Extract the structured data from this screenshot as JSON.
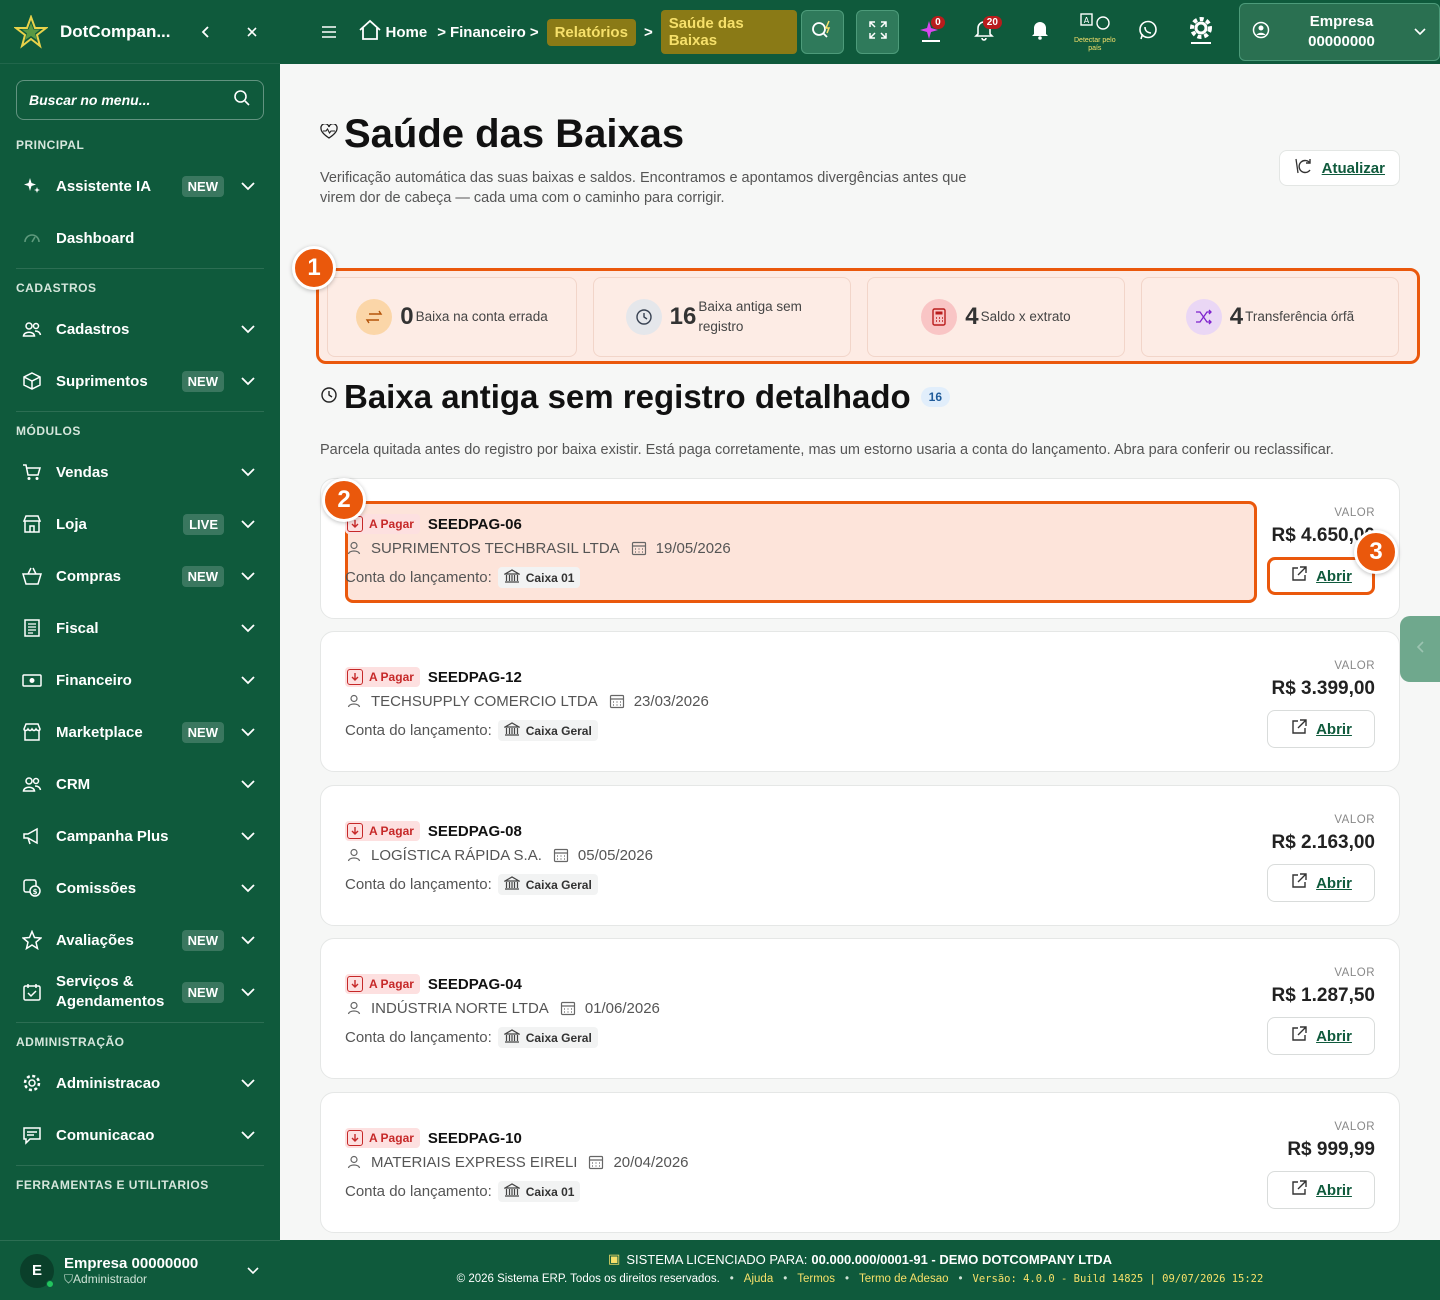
{
  "brand": {
    "name": "DotCompan..."
  },
  "sidebar": {
    "search_placeholder": "Buscar no menu...",
    "sections": {
      "principal": "PRINCIPAL",
      "cadastros": "CADASTROS",
      "modulos": "MÓDULOS",
      "administracao": "ADMINISTRAÇÃO",
      "ferramentas": "FERRAMENTAS E UTILITARIOS"
    },
    "items": [
      {
        "label": "Assistente IA",
        "badge": "NEW",
        "icon": "sparkles-icon"
      },
      {
        "label": "Dashboard",
        "badge": "",
        "icon": "gauge-icon"
      },
      {
        "label": "Cadastros",
        "badge": "",
        "icon": "users-icon"
      },
      {
        "label": "Suprimentos",
        "badge": "NEW",
        "icon": "box-icon"
      },
      {
        "label": "Vendas",
        "badge": "",
        "icon": "cart-icon"
      },
      {
        "label": "Loja",
        "badge": "LIVE",
        "icon": "store-icon"
      },
      {
        "label": "Compras",
        "badge": "NEW",
        "icon": "basket-icon"
      },
      {
        "label": "Fiscal",
        "badge": "",
        "icon": "receipt-icon"
      },
      {
        "label": "Financeiro",
        "badge": "",
        "icon": "money-icon"
      },
      {
        "label": "Marketplace",
        "badge": "NEW",
        "icon": "shop-icon"
      },
      {
        "label": "CRM",
        "badge": "",
        "icon": "users-icon"
      },
      {
        "label": "Campanha Plus",
        "badge": "",
        "icon": "megaphone-icon"
      },
      {
        "label": "Comissões",
        "badge": "",
        "icon": "coins-icon"
      },
      {
        "label": "Avaliações",
        "badge": "NEW",
        "icon": "star-icon"
      },
      {
        "label": "Serviços & Agendamentos",
        "badge": "NEW",
        "icon": "calendar-check-icon"
      },
      {
        "label": "Administracao",
        "badge": "",
        "icon": "gear-icon"
      },
      {
        "label": "Comunicacao",
        "badge": "",
        "icon": "message-icon"
      }
    ],
    "footer": {
      "initial": "E",
      "name": "Empresa 00000000",
      "role": "Administrador"
    }
  },
  "topbar": {
    "crumbs": [
      "Home",
      "Financeiro",
      "Relatórios",
      "Saúde das Baixas"
    ],
    "badge_ai": "0",
    "badge_notifications": "20",
    "geo_label": "Detectar pelo país",
    "company_label": "Empresa",
    "company_id": "00000000"
  },
  "page": {
    "title": "Saúde das Baixas",
    "description": "Verificação automática das suas baixas e saldos. Encontramos e apontamos divergências antes que virem dor de cabeça — cada uma com o caminho para corrigir.",
    "refresh_label": "Atualizar"
  },
  "stats": [
    {
      "num": "0",
      "label": "Baixa na conta errada",
      "icon": "arrows-swap-icon",
      "icon_bg": "#fbd6a8",
      "icon_color": "#b45309"
    },
    {
      "num": "16",
      "label": "Baixa antiga sem registro",
      "icon": "clock-icon",
      "icon_bg": "#e5e7eb",
      "icon_color": "#374151"
    },
    {
      "num": "4",
      "label": "Saldo x extrato",
      "icon": "calculator-icon",
      "icon_bg": "#f9c5c5",
      "icon_color": "#b91c1c"
    },
    {
      "num": "4",
      "label": "Transferência órfã",
      "icon": "shuffle-icon",
      "icon_bg": "#ead7f5",
      "icon_color": "#7e22ce"
    }
  ],
  "callouts": [
    "1",
    "2",
    "3"
  ],
  "section": {
    "title": "Baixa antiga sem registro detalhado",
    "count": "16",
    "description": "Parcela quitada antes do registro por baixa existir. Está paga corretamente, mas um estorno usaria a conta do lançamento. Abra para conferir ou reclassificar."
  },
  "card_labels": {
    "account_prefix": "Conta do lançamento:",
    "value_label": "VALOR",
    "open_label": "Abrir"
  },
  "records": [
    {
      "tag": "A Pagar",
      "id": "SEEDPAG-06",
      "supplier": "SUPRIMENTOS TECHBRASIL LTDA",
      "date": "19/05/2026",
      "account": "Caixa 01",
      "value": "R$ 4.650,00"
    },
    {
      "tag": "A Pagar",
      "id": "SEEDPAG-12",
      "supplier": "TECHSUPPLY COMERCIO LTDA",
      "date": "23/03/2026",
      "account": "Caixa Geral",
      "value": "R$ 3.399,00"
    },
    {
      "tag": "A Pagar",
      "id": "SEEDPAG-08",
      "supplier": "LOGÍSTICA RÁPIDA S.A.",
      "date": "05/05/2026",
      "account": "Caixa Geral",
      "value": "R$ 2.163,00"
    },
    {
      "tag": "A Pagar",
      "id": "SEEDPAG-04",
      "supplier": "INDÚSTRIA NORTE LTDA",
      "date": "01/06/2026",
      "account": "Caixa Geral",
      "value": "R$ 1.287,50"
    },
    {
      "tag": "A Pagar",
      "id": "SEEDPAG-10",
      "supplier": "MATERIAIS EXPRESS EIRELI",
      "date": "20/04/2026",
      "account": "Caixa 01",
      "value": "R$ 999,99"
    }
  ],
  "footer": {
    "license_prefix": "SISTEMA LICENCIADO PARA:",
    "license_holder": "00.000.000/0001-91 - DEMO DOTCOMPANY LTDA",
    "copyright": "© 2026 Sistema ERP. Todos os direitos reservados.",
    "links": [
      "Ajuda",
      "Termos",
      "Termo de Adesao"
    ],
    "version": "Versão: 4.0.0 - Build 14825 | 09/07/2026 15:22"
  },
  "colors": {
    "brand_green": "#0f5a3c",
    "accent_orange": "#ea580c",
    "highlight_yellow": "#f6e06a"
  }
}
